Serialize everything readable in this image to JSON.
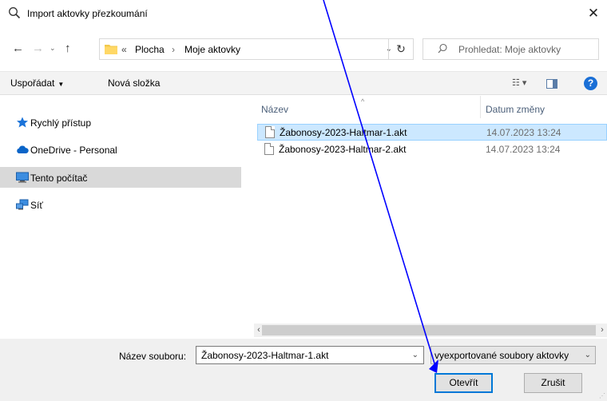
{
  "window": {
    "title": "Import aktovky přezkoumání",
    "close_glyph": "✕"
  },
  "address_bar": {
    "back_glyph": "←",
    "forward_glyph": "→",
    "recent_glyph": "⌄",
    "up_glyph": "↑",
    "overflow_glyph": "«",
    "separator_glyph": "›",
    "breadcrumbs": [
      "Plocha",
      "Moje aktovky"
    ],
    "dropdown_glyph": "⌄",
    "refresh_glyph": "↻",
    "search_placeholder": "Prohledat: Moje aktovky"
  },
  "toolbar": {
    "organize_label": "Uspořádat",
    "organize_caret": "▼",
    "new_folder_label": "Nová složka",
    "views_glyph": "☷ ▾",
    "help_glyph": "?"
  },
  "nav_pane": {
    "items": [
      {
        "label": "Rychlý přístup",
        "icon": "star-icon",
        "selected": false
      },
      {
        "label": "OneDrive - Personal",
        "icon": "cloud-icon",
        "selected": false
      },
      {
        "label": "Tento počítač",
        "icon": "computer-icon",
        "selected": true
      },
      {
        "label": "Síť",
        "icon": "network-icon",
        "selected": false
      }
    ]
  },
  "file_list": {
    "columns": [
      "Název",
      "Datum změny"
    ],
    "sort_glyph": "^",
    "rows": [
      {
        "name": "Žabonosy-2023-Haltmar-1.akt",
        "date": "14.07.2023 13:24",
        "selected": true
      },
      {
        "name": "Žabonosy-2023-Haltmar-2.akt",
        "date": "14.07.2023 13:24",
        "selected": false
      }
    ],
    "scroll_left_glyph": "‹",
    "scroll_right_glyph": "›"
  },
  "footer": {
    "filename_label": "Název souboru:",
    "filename_value": "Žabonosy-2023-Haltmar-1.akt",
    "dropdown_glyph": "⌄",
    "filter_value": "vyexportované soubory aktovky",
    "open_label": "Otevřít",
    "cancel_label": "Zrušit"
  },
  "colors": {
    "selection_bg": "#cce8ff",
    "nav_selected_bg": "#d9d9d9",
    "accent": "#0078d7",
    "annotation_arrow": "#0000ff"
  }
}
